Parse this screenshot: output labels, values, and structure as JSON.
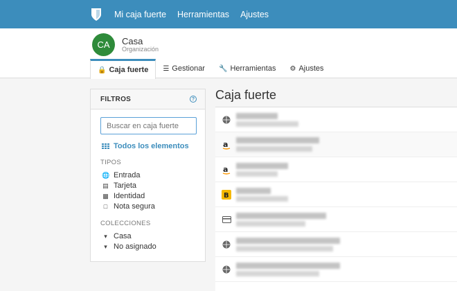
{
  "topnav": {
    "links": [
      "Mi caja fuerte",
      "Herramientas",
      "Ajustes"
    ]
  },
  "org": {
    "initials": "CA",
    "name": "Casa",
    "type": "Organización"
  },
  "tabs": [
    {
      "label": "Caja fuerte",
      "icon": "lock-icon"
    },
    {
      "label": "Gestionar",
      "icon": "sliders-icon"
    },
    {
      "label": "Herramientas",
      "icon": "wrench-icon"
    },
    {
      "label": "Ajustes",
      "icon": "cogs-icon"
    }
  ],
  "filters": {
    "title": "FILTROS",
    "search_placeholder": "Buscar en caja fuerte",
    "all_items": "Todos los elementos",
    "types_label": "TIPOS",
    "types": [
      "Entrada",
      "Tarjeta",
      "Identidad",
      "Nota segura"
    ],
    "collections_label": "COLECCIONES",
    "collections": [
      "Casa",
      "No asignado"
    ]
  },
  "main": {
    "title": "Caja fuerte",
    "rows": [
      {
        "icon": "globe-icon"
      },
      {
        "icon": "amazon-icon"
      },
      {
        "icon": "amazon-icon"
      },
      {
        "icon": "bank-logo-icon"
      },
      {
        "icon": "card-icon"
      },
      {
        "icon": "globe-icon"
      },
      {
        "icon": "globe-icon"
      }
    ]
  },
  "colors": {
    "navbar": "#3c8dbc",
    "avatar": "#2e8b3a",
    "accent": "#3c8dbc"
  }
}
